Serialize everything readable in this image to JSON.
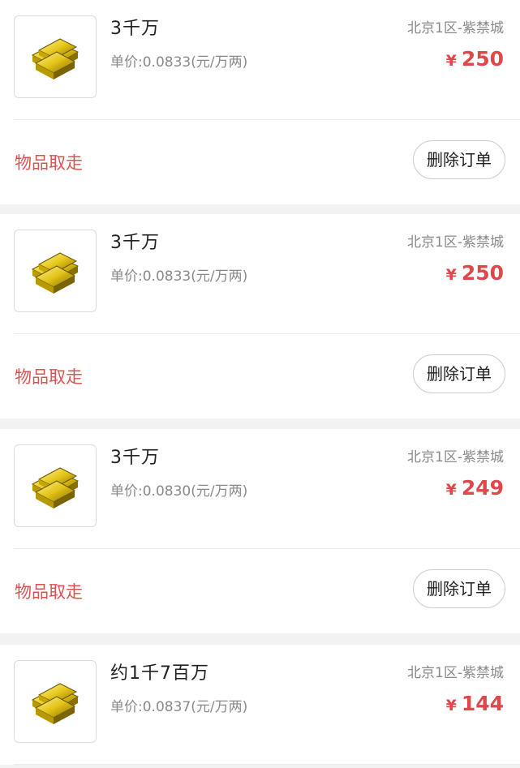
{
  "orders": [
    {
      "quantity": "3千万",
      "unit_price": "单价:0.0833(元/万两)",
      "server": "北京1区-紫禁城",
      "currency": "¥",
      "price": "250",
      "status": "物品取走",
      "delete_label": "删除订单",
      "icon": "gold-bars-icon"
    },
    {
      "quantity": "3千万",
      "unit_price": "单价:0.0833(元/万两)",
      "server": "北京1区-紫禁城",
      "currency": "¥",
      "price": "250",
      "status": "物品取走",
      "delete_label": "删除订单",
      "icon": "gold-bars-icon"
    },
    {
      "quantity": "3千万",
      "unit_price": "单价:0.0830(元/万两)",
      "server": "北京1区-紫禁城",
      "currency": "¥",
      "price": "249",
      "status": "物品取走",
      "delete_label": "删除订单",
      "icon": "gold-bars-icon"
    },
    {
      "quantity": "约1千7百万",
      "unit_price": "单价:0.0837(元/万两)",
      "server": "北京1区-紫禁城",
      "currency": "¥",
      "price": "144",
      "icon": "gold-bars-icon"
    }
  ],
  "colors": {
    "price_red": "#e0474a",
    "status_red": "#d9534f",
    "gold": "#e6c619"
  }
}
